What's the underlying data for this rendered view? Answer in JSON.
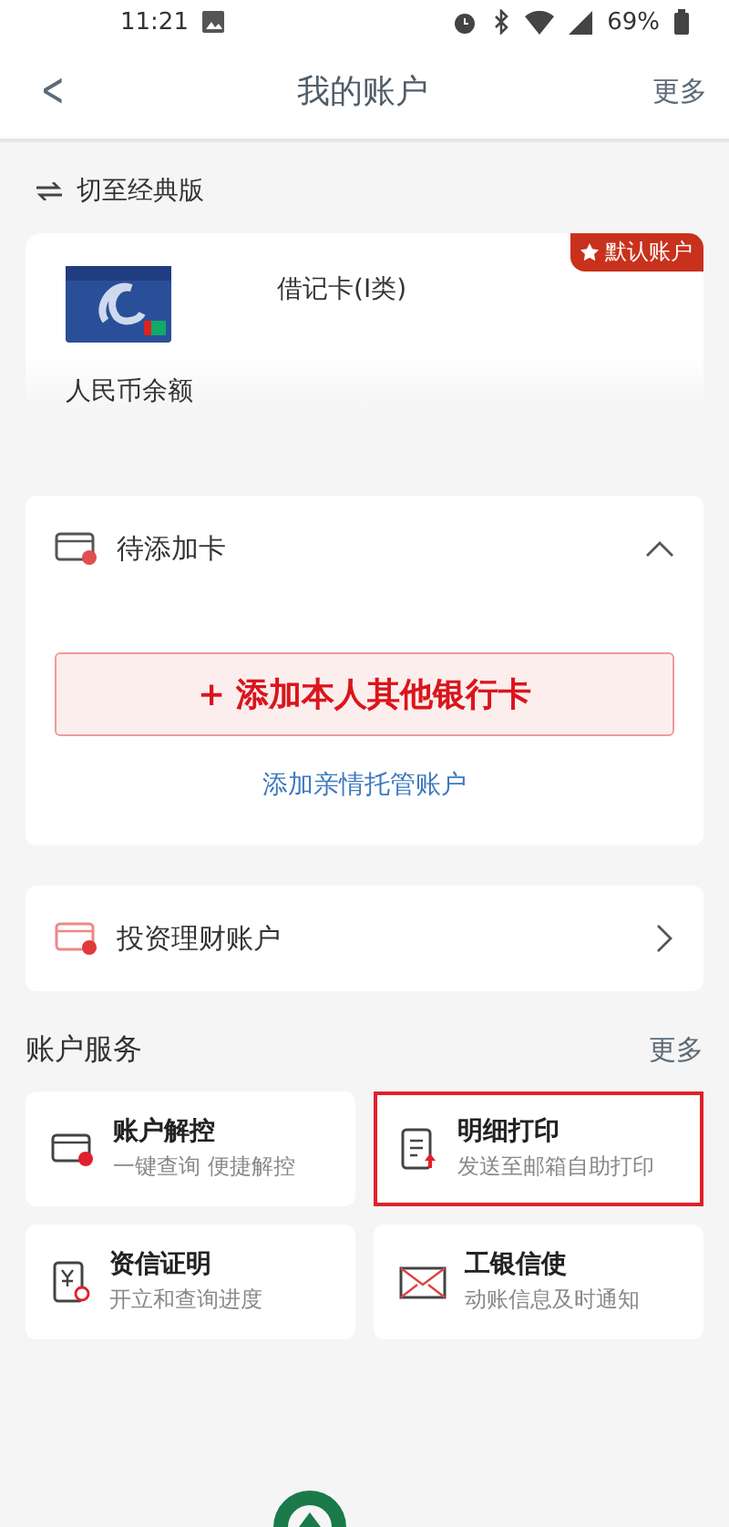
{
  "status_bar": {
    "time": "11:21",
    "battery": "69%"
  },
  "header": {
    "back": "<",
    "title": "我的账户",
    "more": "更多"
  },
  "switch_version": {
    "label": "切至经典版"
  },
  "account_card": {
    "badge": "默认账户",
    "card_type": "借记卡(I类)",
    "balance_label": "人民币余额",
    "is_default": true
  },
  "pending_cards": {
    "title": "待添加卡",
    "expanded": true,
    "add_button": "添加本人其他银行卡",
    "add_prefix": "+",
    "link": "添加亲情托管账户"
  },
  "investment": {
    "title": "投资理财账户"
  },
  "services": {
    "title": "账户服务",
    "more": "更多",
    "items": [
      {
        "kind": "unlock",
        "title": "账户解控",
        "subtitle": "一键查询 便捷解控",
        "highlighted": false
      },
      {
        "kind": "print",
        "title": "明细打印",
        "subtitle": "发送至邮箱自助打印",
        "highlighted": true
      },
      {
        "kind": "certificate",
        "title": "资信证明",
        "subtitle": "开立和查询进度",
        "highlighted": false
      },
      {
        "kind": "mail",
        "title": "工银信使",
        "subtitle": "动账信息及时通知",
        "highlighted": false
      }
    ]
  }
}
